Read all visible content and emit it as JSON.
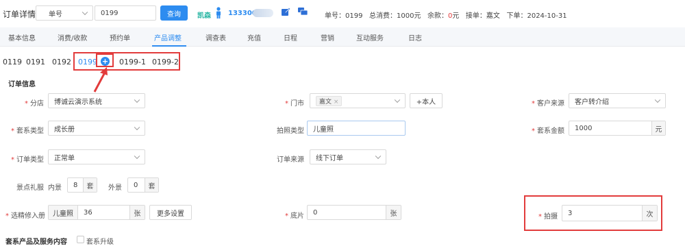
{
  "header": {
    "title": "订单详情",
    "search_type": "单号",
    "search_value": "0199",
    "query_label": "查询",
    "customer_name": "凯森",
    "phone_prefix": "133300",
    "info": {
      "order_no": "单号：0199",
      "total": "总消费：1000元",
      "balance_label": "余款：",
      "balance_value": "0",
      "balance_unit": "元",
      "receiver": "接单：嘉文",
      "order_date": "下单：2024-10-31"
    }
  },
  "tabs": [
    "基本信息",
    "消费/收款",
    "预约单",
    "产品调整",
    "调查表",
    "充值",
    "日程",
    "营销",
    "互动服务",
    "日志"
  ],
  "active_tab": "产品调整",
  "orders": [
    "0119",
    "0191",
    "0192",
    "0199",
    "0199-1",
    "0199-2"
  ],
  "active_order": "0199",
  "form": {
    "section_title": "订单信息",
    "branch": {
      "label": "分店",
      "value": "博诚云演示系统"
    },
    "store": {
      "label": "门市",
      "tag": "嘉文",
      "self_button": "+本人"
    },
    "customer_source": {
      "label": "客户来源",
      "value": "客户转介绍"
    },
    "package_type": {
      "label": "套系类型",
      "value": "成长册"
    },
    "shoot_type": {
      "label": "拍照类型",
      "value": "儿童照"
    },
    "package_amount": {
      "label": "套系金额",
      "value": "1000",
      "unit": "元"
    },
    "order_type": {
      "label": "订单类型",
      "value": "正常单"
    },
    "order_source": {
      "label": "订单来源",
      "value": "线下订单"
    },
    "scene_dress": {
      "label": "景点礼服",
      "inner_label": "内景",
      "inner_value": "8",
      "inner_unit": "套",
      "outer_label": "外景",
      "outer_value": "0",
      "outer_unit": "套"
    },
    "selected_album": {
      "label": "选精修入册",
      "prefix": "儿童照",
      "value": "36",
      "unit": "张",
      "more_button": "更多设置"
    },
    "base_film": {
      "label": "底片",
      "value": "0",
      "unit": "张"
    },
    "shoot": {
      "label": "拍摄",
      "value": "3",
      "unit": "次"
    },
    "bottom_section_title": "套系产品及服务内容",
    "upgrade_label": "套系升级"
  }
}
